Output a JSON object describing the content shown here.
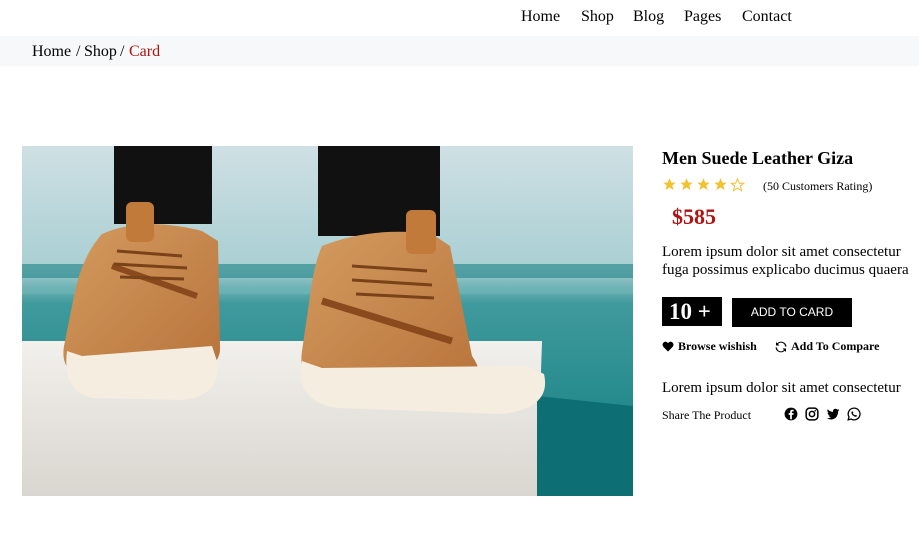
{
  "nav": {
    "items": [
      {
        "label": "Home"
      },
      {
        "label": "Shop"
      },
      {
        "label": "Blog"
      },
      {
        "label": "Pages"
      },
      {
        "label": "Contact"
      }
    ]
  },
  "breadcrumb": {
    "home": "Home",
    "sep1": " / ",
    "shop": "Shop",
    "sep2": " / ",
    "current": "Card"
  },
  "product": {
    "title": "Men Suede Leather Giza",
    "rating": 4,
    "rating_max": 5,
    "rating_text": "(50 Customers Rating)",
    "price": "$585",
    "description_line1": "Lorem ipsum dolor sit amet consectetur",
    "description_line2": "fuga possimus explicabo ducimus quaera",
    "quantity": "10",
    "quantity_plus": "+",
    "add_to_cart_label": "ADD TO CARD",
    "wishlist_label": "Browse wishish",
    "compare_label": "Add To Compare",
    "description2": "Lorem ipsum dolor sit amet consectetur",
    "share_label": "Share The Product",
    "socials": [
      "facebook-icon",
      "instagram-icon",
      "twitter-icon",
      "whatsapp-icon"
    ]
  },
  "colors": {
    "accent": "#b01212",
    "star": "#f2c12e",
    "breadcrumb_bg": "#f7f8f9"
  }
}
